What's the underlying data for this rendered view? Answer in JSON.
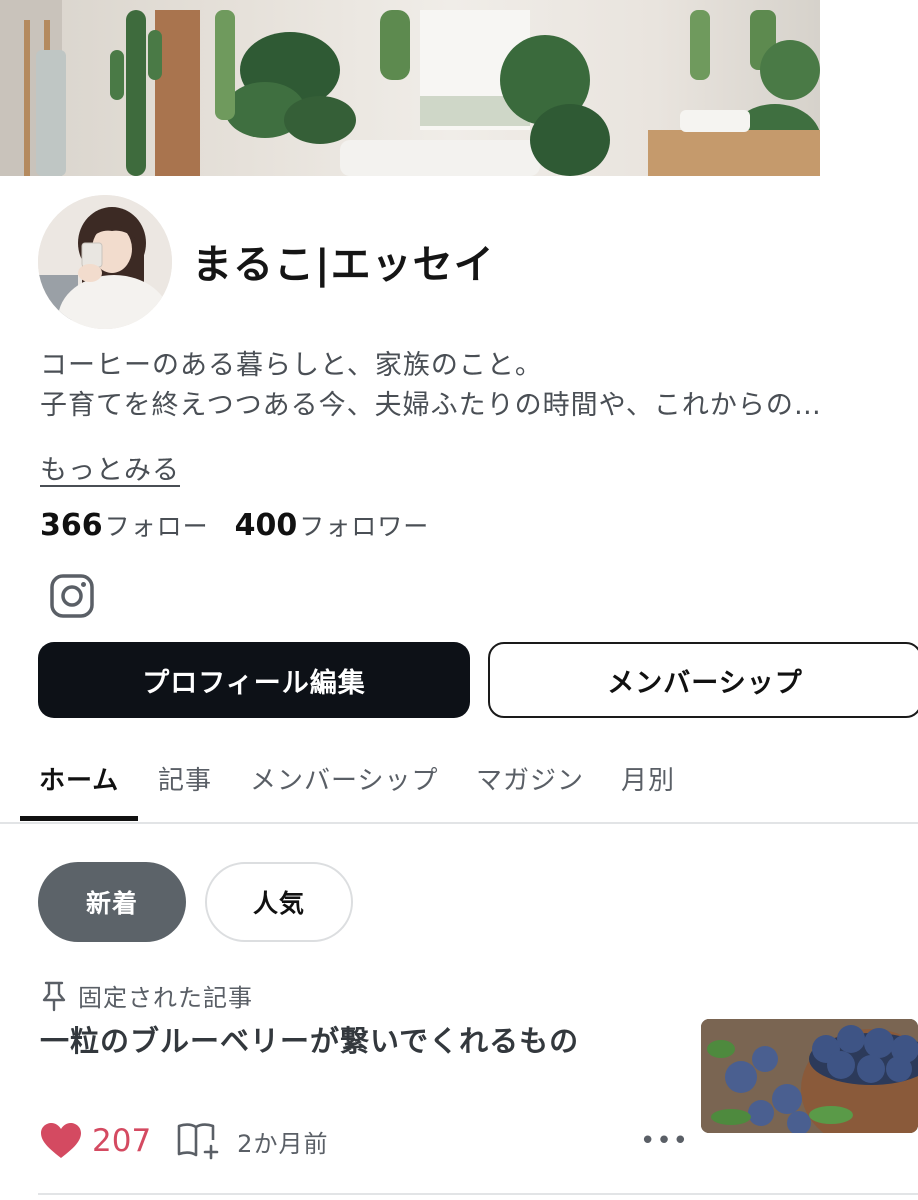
{
  "profile": {
    "name": "まるこ|エッセイ",
    "bio_line1": "コーヒーのある暮らしと、家族のこと。",
    "bio_line2": "子育てを終えつつある今、夫婦ふたりの時間や、これからの…",
    "more_label": "もっとみる",
    "following_count": "366",
    "following_label": "フォロー",
    "followers_count": "400",
    "followers_label": "フォロワー",
    "social_icon": "instagram-icon"
  },
  "actions": {
    "edit_label": "プロフィール編集",
    "membership_label": "メンバーシップ"
  },
  "tabs": [
    {
      "label": "ホーム",
      "active": true
    },
    {
      "label": "記事",
      "active": false
    },
    {
      "label": "メンバーシップ",
      "active": false
    },
    {
      "label": "マガジン",
      "active": false
    },
    {
      "label": "月別",
      "active": false
    }
  ],
  "filters": {
    "new_label": "新着",
    "popular_label": "人気",
    "selected": "新着"
  },
  "article": {
    "pinned_label": "固定された記事",
    "title": "一粒のブルーベリーが繋いでくれるもの",
    "likes": "207",
    "posted_ago": "2か月前",
    "more_label": "•••"
  },
  "colors": {
    "primary_button": "#0d1117",
    "like_red": "#d44a61",
    "pill_selected": "#5c6369"
  }
}
